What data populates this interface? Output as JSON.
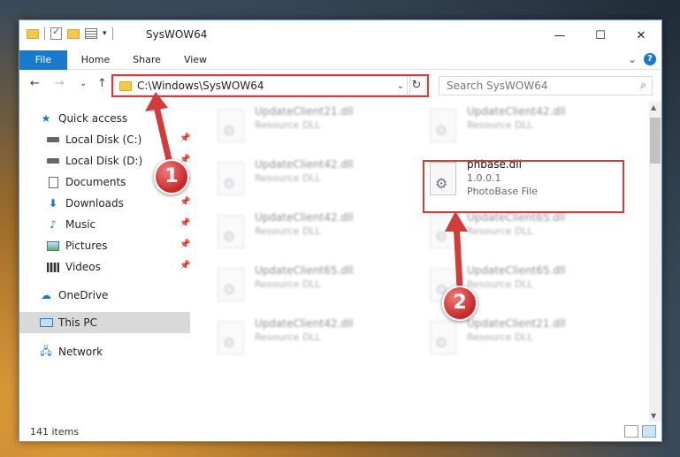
{
  "window": {
    "title": "SysWOW64",
    "controls": {
      "minimize": "—",
      "maximize": "☐",
      "close": "✕"
    }
  },
  "ribbon": {
    "tabs": [
      "File",
      "Home",
      "Share",
      "View"
    ],
    "collapse": "⌄",
    "help": "?"
  },
  "nav": {
    "back": "←",
    "forward": "→",
    "recent": "⌄",
    "up": "↑",
    "address": "C:\\Windows\\SysWOW64",
    "address_dropdown": "⌄",
    "refresh": "↻",
    "search_placeholder": "Search SysWOW64",
    "search_icon": "⌕"
  },
  "sidebar": {
    "quick_access": "Quick access",
    "items": [
      {
        "label": "Local Disk (C:)",
        "icon": "drive-icon"
      },
      {
        "label": "Local Disk (D:)",
        "icon": "drive-icon"
      },
      {
        "label": "Documents",
        "icon": "documents-icon"
      },
      {
        "label": "Downloads",
        "icon": "downloads-icon"
      },
      {
        "label": "Music",
        "icon": "music-icon"
      },
      {
        "label": "Pictures",
        "icon": "pictures-icon"
      },
      {
        "label": "Videos",
        "icon": "videos-icon"
      }
    ],
    "onedrive": "OneDrive",
    "this_pc": "This PC",
    "network": "Network",
    "pin_glyph": "📌"
  },
  "files": {
    "left_column": [
      {
        "name": "UpdateClient21.dll",
        "type": "Resource DLL"
      },
      {
        "name": "UpdateClient42.dll",
        "type": "Resource DLL"
      },
      {
        "name": "UpdateClient42.dll",
        "type": "Resource DLL"
      },
      {
        "name": "UpdateClient65.dll",
        "type": "Resource DLL"
      },
      {
        "name": "UpdateClient42.dll",
        "type": "Resource DLL"
      }
    ],
    "right_column": [
      {
        "name": "UpdateClient42.dll",
        "type": "Resource DLL"
      },
      {
        "name": "UpdateClient65.dll",
        "type": "Resource DLL"
      },
      {
        "name": "UpdateClient65.dll",
        "type": "Resource DLL"
      },
      {
        "name": "UpdateClient21.dll",
        "type": "Resource DLL"
      }
    ],
    "selected": {
      "name": "phbase.dll",
      "version": "1.0.0.1",
      "description": "PhotoBase File"
    }
  },
  "status": {
    "item_count": "141 items"
  },
  "annotations": {
    "badge1": "1",
    "badge2": "2",
    "color": "#d43b3b"
  }
}
